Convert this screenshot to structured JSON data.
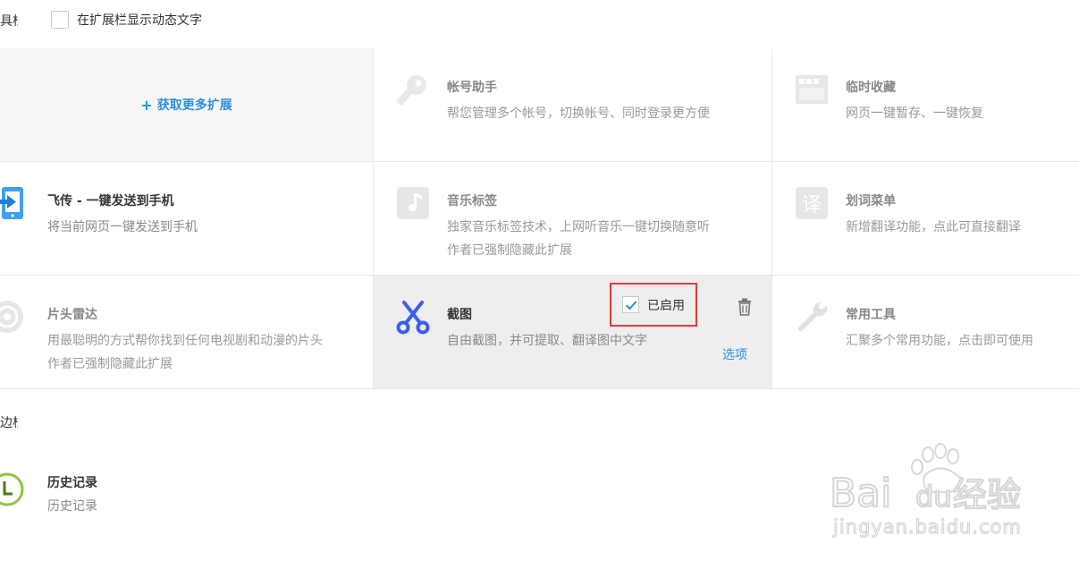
{
  "toolbar_section": {
    "label": "工具栏",
    "show_dynamic_text_label": "在扩展栏显示动态文字",
    "show_dynamic_text_checked": false
  },
  "get_more": {
    "label": "获取更多扩展"
  },
  "extensions": [
    {
      "id": "account",
      "title": "帐号助手",
      "desc": "帮您管理多个帐号，切换帐号、同时登录更方便",
      "enabled": false,
      "icon": "key-icon"
    },
    {
      "id": "temp",
      "title": "临时收藏",
      "desc": "网页一键暂存、一键恢复",
      "enabled": false,
      "icon": "clip-icon"
    },
    {
      "id": "feichuan",
      "title": "飞传 - 一键发送到手机",
      "desc": "将当前网页一键发送到手机",
      "enabled": true,
      "icon": "send-to-phone-icon"
    },
    {
      "id": "music",
      "title": "音乐标签",
      "desc": "独家音乐标签技术，上网听音乐一键切换随意听",
      "desc2": "作者已强制隐藏此扩展",
      "enabled": false,
      "icon": "music-note-icon"
    },
    {
      "id": "translate",
      "title": "划词菜单",
      "desc": "新增翻译功能，点此可直接翻译",
      "enabled": false,
      "icon": "translate-icon"
    },
    {
      "id": "radar",
      "title": "片头雷达",
      "desc": "用最聪明的方式帮你找到任何电视剧和动漫的片头",
      "desc2": "作者已强制隐藏此扩展",
      "enabled": false,
      "icon": "radar-icon"
    },
    {
      "id": "screenshot",
      "title": "截图",
      "desc": "自由截图，并可提取、翻译图中文字",
      "enabled": true,
      "enabled_label": "已启用",
      "options_label": "选项",
      "icon": "scissors-icon"
    },
    {
      "id": "tools",
      "title": "常用工具",
      "desc": "汇聚多个常用功能，点击即可使用",
      "enabled": false,
      "icon": "wrench-icon"
    }
  ],
  "sidebar_section": {
    "label": "侧边栏"
  },
  "history": {
    "title": "历史记录",
    "desc": "历史记录",
    "icon": "clock-icon"
  },
  "watermark": {
    "brand": "Bai",
    "brand2": "du",
    "cn": "经验",
    "url": "jingyan.baidu.com"
  },
  "colors": {
    "accent": "#2d8fdd",
    "highlight_border": "#e3393c",
    "active_bg": "#eeeeee"
  }
}
